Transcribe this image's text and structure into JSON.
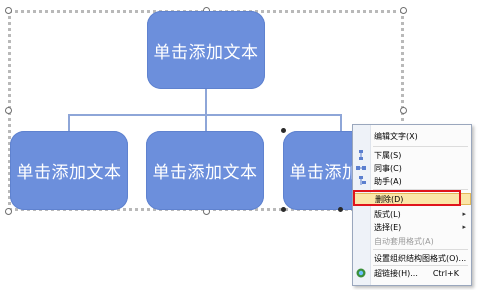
{
  "chart": {
    "nodes": {
      "top": "单击添加文本",
      "left": "单击添加文本",
      "middle": "单击添加文本",
      "right": "单击添加文本"
    },
    "colors": {
      "node": "#6c8fdc",
      "connector": "#8ea6d8"
    }
  },
  "context_menu": {
    "edit_text": "编辑文字(X)",
    "subordinate": "下属(S)",
    "coworker": "同事(C)",
    "assistant": "助手(A)",
    "delete": "删除(D)",
    "layout": "版式(L)",
    "select": "选择(E)",
    "autoformat": "自动套用格式(A)",
    "format": "设置组织结构图格式(O)...",
    "hyperlink": "超链接(H)...",
    "hyperlink_shortcut": "Ctrl+K",
    "highlight_color": "#e0141c"
  }
}
